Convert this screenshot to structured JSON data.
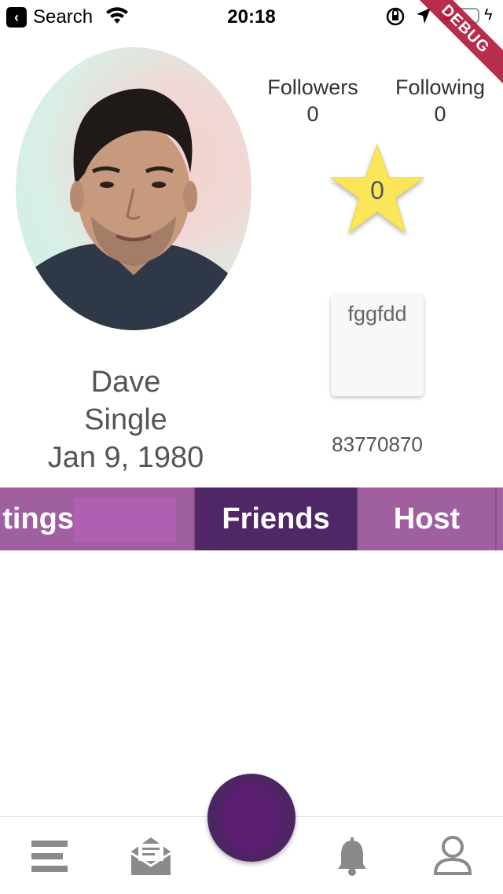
{
  "status_bar": {
    "back_label": "Search",
    "time": "20:18",
    "debug_label": "DEBUG"
  },
  "profile": {
    "name": "Dave",
    "status": "Single",
    "birthday": "Jan 9, 1980",
    "followers_label": "Followers",
    "followers_count": "0",
    "following_label": "Following",
    "following_count": "0",
    "star_rating": "0",
    "card_text": "fggfdd",
    "phone": "83770870"
  },
  "tabs": [
    {
      "label": "tings",
      "active": false
    },
    {
      "label": "Friends",
      "active": true
    },
    {
      "label": "Host",
      "active": false
    }
  ],
  "bottom_nav": {
    "items": [
      "menu-icon",
      "mail-icon",
      "center-fab",
      "bell-icon",
      "user-icon"
    ]
  },
  "colors": {
    "tab_bar": "#a0609f",
    "tab_active": "#4f2766",
    "fab": "#4e2564",
    "icon_gray": "#8a8a8a",
    "star": "#fbe65a"
  }
}
